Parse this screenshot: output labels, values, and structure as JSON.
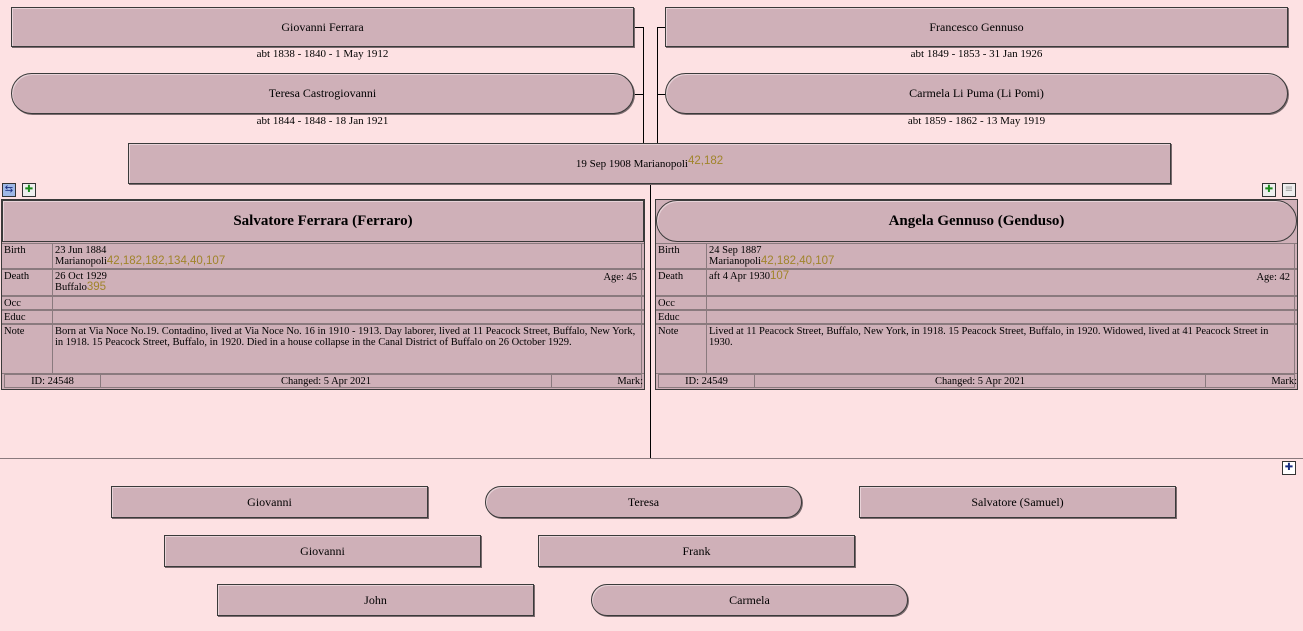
{
  "grandparents": {
    "paternal_father": {
      "name": "Giovanni Ferrara",
      "dates": "abt 1838 - 1840 - 1 May 1912"
    },
    "paternal_mother": {
      "name": "Teresa Castrogiovanni",
      "dates": "abt 1844 - 1848 - 18 Jan 1921"
    },
    "maternal_father": {
      "name": "Francesco Gennuso",
      "dates": "abt 1849 - 1853 - 31 Jan 1926"
    },
    "maternal_mother": {
      "name": "Carmela Li Puma (Li Pomi)",
      "dates": "abt 1859 - 1862 - 13 May 1919"
    }
  },
  "marriage": {
    "text": "19 Sep 1908  Marianopoli",
    "citations": "42,182"
  },
  "husband": {
    "name": "Salvatore Ferrara (Ferraro)",
    "birth_label": "Birth",
    "birth_date": "23 Jun 1884",
    "birth_place": "Marianopoli",
    "birth_cites": "42,182,182,134,40,107",
    "death_label": "Death",
    "death_date": "26 Oct 1929",
    "death_place": "Buffalo",
    "death_cites": "395",
    "age": "Age: 45",
    "occ_label": "Occ",
    "educ_label": "Educ",
    "note_label": "Note",
    "note": "Born at Via Noce No.19.  Contadino, lived at Via Noce No. 16 in 1910 - 1913.  Day laborer, lived at 11 Peacock Street, Buffalo, New York, in 1918.  15 Peacock Street, Buffalo, in 1920.  Died in a house collapse in the Canal District of Buffalo on 26 October 1929.",
    "id": "ID: 24548",
    "changed": "Changed: 5 Apr 2021",
    "mark": "Mark:"
  },
  "wife": {
    "name": "Angela Gennuso (Genduso)",
    "birth_label": "Birth",
    "birth_date": "24 Sep 1887",
    "birth_place": "Marianopoli",
    "birth_cites": "42,182,40,107",
    "death_label": "Death",
    "death_date": "aft 4 Apr 1930",
    "death_cites": "107",
    "age": "Age: 42",
    "occ_label": "Occ",
    "educ_label": "Educ",
    "note_label": "Note",
    "note": "Lived at 11 Peacock Street, Buffalo, New York, in 1918.  15 Peacock Street, Buffalo, in 1920.  Widowed, lived at 41 Peacock Street in 1930.",
    "id": "ID: 24549",
    "changed": "Changed: 5 Apr 2021",
    "mark": "Mark:"
  },
  "children": [
    {
      "name": "Giovanni",
      "sex": "male"
    },
    {
      "name": "Teresa",
      "sex": "female"
    },
    {
      "name": "Salvatore (Samuel)",
      "sex": "male"
    },
    {
      "name": "Giovanni",
      "sex": "male"
    },
    {
      "name": "Frank",
      "sex": "male"
    },
    {
      "name": "John",
      "sex": "male"
    },
    {
      "name": "Carmela",
      "sex": "female"
    }
  ],
  "icons": {
    "husband_left_1": "family-view-icon",
    "husband_left_2": "add-spouse-icon",
    "wife_right_1": "add-spouse-icon",
    "wife_right_2": "spouse-list-icon",
    "children_add": "add-child-icon"
  },
  "colors": {
    "background": "#fde1e3",
    "box": "#cfb0b8",
    "citation": "#a0842a"
  }
}
